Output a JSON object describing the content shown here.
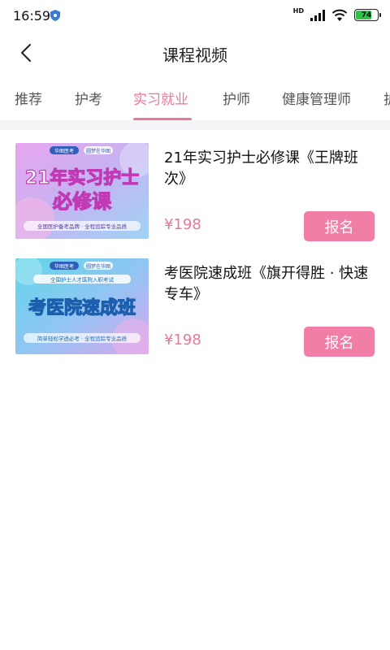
{
  "status_bar": {
    "time": "16:59",
    "network_label": "HD",
    "battery_level": "74",
    "icons": [
      "shield-icon",
      "signal-icon",
      "wifi-icon",
      "battery-icon"
    ]
  },
  "header": {
    "title": "课程视频",
    "back_icon": "chevron-left-icon"
  },
  "tabs": [
    {
      "label": "推荐",
      "active": false
    },
    {
      "label": "护考",
      "active": false
    },
    {
      "label": "实习就业",
      "active": true
    },
    {
      "label": "护师",
      "active": false
    },
    {
      "label": "健康管理师",
      "active": false
    },
    {
      "label": "护",
      "active": false
    }
  ],
  "courses": [
    {
      "title": "21年实习护士必修课《王牌班次》",
      "price": "¥198",
      "button": "报名",
      "thumbnail": {
        "main_text_line1": "21年实习护士",
        "main_text_line2": "必修课",
        "top_badge": "华图医考",
        "top_tag": "圆梦在华图",
        "caption": "全国医护备考品牌 · 全程追踪专业品质"
      }
    },
    {
      "title": "考医院速成班《旗开得胜 · 快速专车》",
      "price": "¥198",
      "button": "报名",
      "thumbnail": {
        "main_text_line1": "考医院速成班",
        "top_badge": "华图医考",
        "top_tag": "圆梦在华图",
        "subtitle": "全国护士人才医院入职考试",
        "caption": "简单轻松学透必考 · 全程追踪专业品质"
      }
    }
  ],
  "colors": {
    "accent": "#e8779b",
    "button_bg": "#f17ea6",
    "battery": "#2fc24a"
  }
}
